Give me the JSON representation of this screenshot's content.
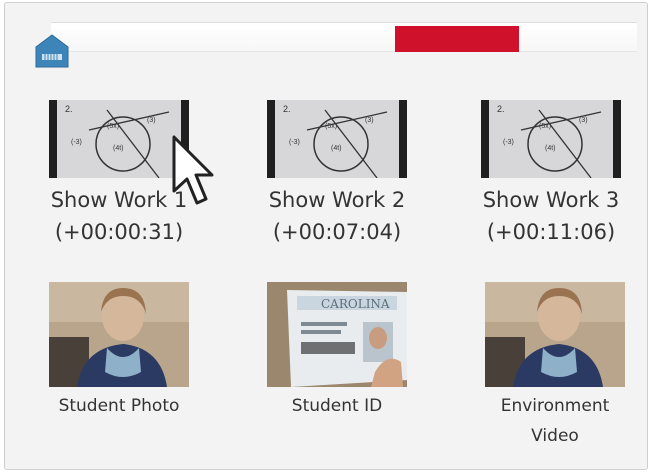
{
  "timeline": {
    "marker_color": "#d0112b"
  },
  "work_items": [
    {
      "label": "Show Work 1",
      "timestamp": "(+00:00:31)"
    },
    {
      "label": "Show Work 2",
      "timestamp": "(+00:07:04)"
    },
    {
      "label": "Show Work 3",
      "timestamp": "(+00:11:06)"
    }
  ],
  "media_items": [
    {
      "label": "Student Photo"
    },
    {
      "label": "Student ID",
      "card_text": "CAROLINA"
    },
    {
      "label": "Environment",
      "label_line2": "Video"
    }
  ],
  "icons": {
    "home": "home-marker-icon",
    "cursor": "mouse-pointer-icon"
  }
}
